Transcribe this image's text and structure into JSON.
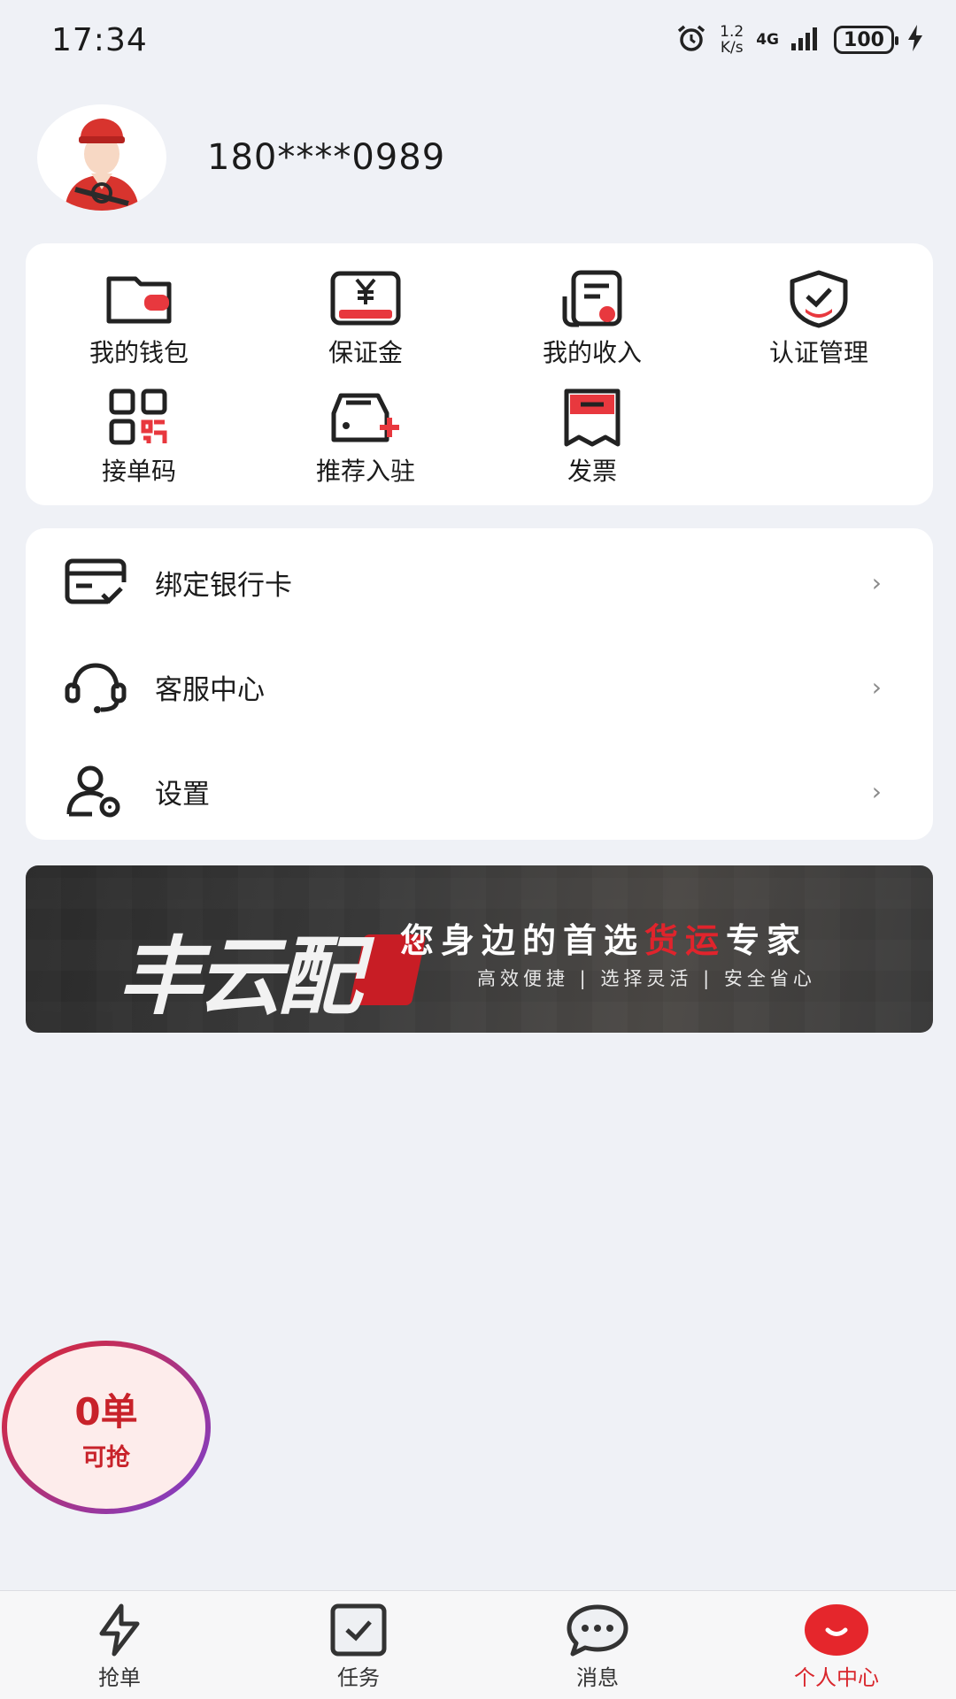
{
  "status_bar": {
    "time": "17:34",
    "speed_value": "1.2",
    "speed_unit": "K/s",
    "network": "4G",
    "battery": "100"
  },
  "profile": {
    "phone": "180****0989"
  },
  "quick_actions": [
    {
      "label": "我的钱包",
      "icon": "wallet-icon"
    },
    {
      "label": "保证金",
      "icon": "deposit-yen-icon"
    },
    {
      "label": "我的收入",
      "icon": "income-document-icon"
    },
    {
      "label": "认证管理",
      "icon": "shield-check-icon"
    },
    {
      "label": "接单码",
      "icon": "qr-code-icon"
    },
    {
      "label": "推荐入驻",
      "icon": "truck-plus-icon"
    },
    {
      "label": "发票",
      "icon": "invoice-icon"
    }
  ],
  "menu": [
    {
      "label": "绑定银行卡",
      "icon": "bank-card-icon"
    },
    {
      "label": "客服中心",
      "icon": "headset-icon"
    },
    {
      "label": "设置",
      "icon": "user-settings-icon"
    }
  ],
  "banner": {
    "logo_text": "丰云配",
    "slogan_pre": "您身边的首选",
    "slogan_highlight": "货运",
    "slogan_post": "专家",
    "subtitle": "高效便捷 | 选择灵活 | 安全省心"
  },
  "grab": {
    "count": "0单",
    "label": "可抢"
  },
  "tabs": [
    {
      "label": "抢单",
      "icon": "lightning-icon"
    },
    {
      "label": "任务",
      "icon": "task-check-icon"
    },
    {
      "label": "消息",
      "icon": "chat-bubble-icon"
    },
    {
      "label": "个人中心",
      "icon": "profile-smile-icon"
    }
  ],
  "colors": {
    "accent": "#d9262c",
    "background": "#eff1f6"
  }
}
